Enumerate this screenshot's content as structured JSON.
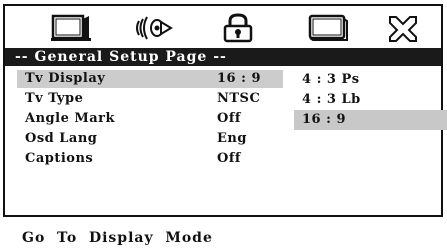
{
  "icons": [
    {
      "name": "tv-icon"
    },
    {
      "name": "audio-icon"
    },
    {
      "name": "lock-icon"
    },
    {
      "name": "monitor-icon"
    },
    {
      "name": "tools-icon"
    }
  ],
  "title": "-- General Setup Page --",
  "menu": {
    "items": [
      {
        "label": "Tv Display",
        "value": "16 : 9"
      },
      {
        "label": "Tv Type",
        "value": "NTSC"
      },
      {
        "label": "Angle Mark",
        "value": "Off"
      },
      {
        "label": "Osd Lang",
        "value": "Eng"
      },
      {
        "label": "Captions",
        "value": "Off"
      }
    ]
  },
  "submenu": {
    "options": [
      "4 : 3 Ps",
      "4 : 3 Lb",
      "16 : 9"
    ],
    "selected": "16 : 9"
  },
  "footer": "Go  To  Display  Mode",
  "colors": {
    "title_bg": "#1a1a1a",
    "highlight": "#cccccc"
  }
}
